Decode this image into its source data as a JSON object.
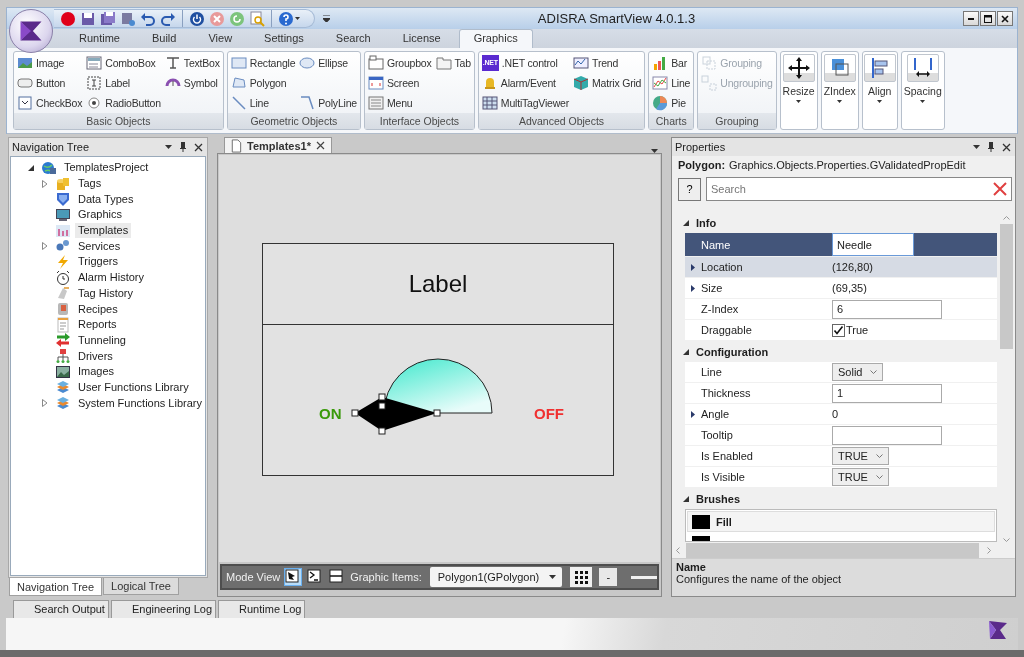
{
  "window": {
    "title": "ADISRA SmartView 4.0.1.3"
  },
  "ribbon_tabs": [
    {
      "label": "Runtime",
      "selected": false
    },
    {
      "label": "Build",
      "selected": false
    },
    {
      "label": "View",
      "selected": false
    },
    {
      "label": "Settings",
      "selected": false
    },
    {
      "label": "Search",
      "selected": false
    },
    {
      "label": "License",
      "selected": false
    },
    {
      "label": "Graphics",
      "selected": true
    }
  ],
  "ribbon_groups": [
    {
      "kind": "small",
      "title": "Basic Objects",
      "rows": [
        [
          {
            "label": "Image",
            "disabled": false
          },
          {
            "label": "ComboBox",
            "disabled": false
          },
          {
            "label": "TextBox",
            "disabled": false
          }
        ],
        [
          {
            "label": "Button",
            "disabled": false
          },
          {
            "label": "Label",
            "disabled": false
          },
          {
            "label": "Symbol",
            "disabled": false
          }
        ],
        [
          {
            "label": "CheckBox",
            "disabled": false
          },
          {
            "label": "RadioButton",
            "disabled": false
          }
        ]
      ]
    },
    {
      "kind": "small",
      "title": "Geometric Objects",
      "rows": [
        [
          {
            "label": "Rectangle",
            "disabled": false
          },
          {
            "label": "Ellipse",
            "disabled": false
          }
        ],
        [
          {
            "label": "Polygon",
            "disabled": false
          }
        ],
        [
          {
            "label": "Line",
            "disabled": false
          },
          {
            "label": "PolyLine",
            "disabled": false
          }
        ]
      ]
    },
    {
      "kind": "small",
      "title": "Interface Objects",
      "rows": [
        [
          {
            "label": "Groupbox",
            "disabled": false
          },
          {
            "label": "Tab",
            "disabled": false
          }
        ],
        [
          {
            "label": "Screen",
            "disabled": false
          }
        ],
        [
          {
            "label": "Menu",
            "disabled": false
          }
        ]
      ]
    },
    {
      "kind": "small",
      "title": "Advanced Objects",
      "rows": [
        [
          {
            "label": ".NET control",
            "badge": ".NET",
            "disabled": false
          },
          {
            "label": "Trend",
            "disabled": false
          }
        ],
        [
          {
            "label": "Alarm/Event",
            "disabled": false
          },
          {
            "label": "Matrix Grid",
            "disabled": false
          }
        ],
        [
          {
            "label": "MultiTagViewer",
            "disabled": false
          }
        ]
      ]
    },
    {
      "kind": "small",
      "title": "Charts",
      "rows": [
        [
          {
            "label": "Bar",
            "disabled": false
          }
        ],
        [
          {
            "label": "Line",
            "disabled": false
          }
        ],
        [
          {
            "label": "Pie",
            "disabled": false
          }
        ]
      ]
    },
    {
      "kind": "small",
      "title": "Grouping",
      "rows": [
        [
          {
            "label": "Grouping",
            "disabled": true
          }
        ],
        [
          {
            "label": "Ungrouping",
            "disabled": true
          }
        ]
      ]
    },
    {
      "kind": "large",
      "label": "Resize"
    },
    {
      "kind": "large",
      "label": "ZIndex"
    },
    {
      "kind": "large",
      "label": "Align"
    },
    {
      "kind": "large",
      "label": "Spacing"
    }
  ],
  "navigation_tree": {
    "title": "Navigation Tree",
    "items": [
      {
        "label": "TemplatesProject",
        "expanded": true,
        "selected": false,
        "children": [
          {
            "label": "Tags",
            "expanded": false,
            "selected": false
          },
          {
            "label": "Data Types",
            "selected": false
          },
          {
            "label": "Graphics",
            "selected": false
          },
          {
            "label": "Templates",
            "selected": true
          },
          {
            "label": "Services",
            "expanded": false,
            "selected": false
          },
          {
            "label": "Triggers",
            "selected": false
          },
          {
            "label": "Alarm History",
            "selected": false
          },
          {
            "label": "Tag History",
            "selected": false
          },
          {
            "label": "Recipes",
            "selected": false
          },
          {
            "label": "Reports",
            "selected": false
          },
          {
            "label": "Tunneling",
            "selected": false
          },
          {
            "label": "Drivers",
            "selected": false
          },
          {
            "label": "Images",
            "selected": false
          },
          {
            "label": "User Functions Library",
            "selected": false
          },
          {
            "label": "System Functions Library",
            "expanded": false,
            "selected": false
          }
        ]
      }
    ]
  },
  "left_panel_tabs": [
    {
      "label": "Navigation Tree",
      "selected": true
    },
    {
      "label": "Logical Tree",
      "selected": false
    }
  ],
  "document": {
    "tabs": [
      {
        "label": "Templates1*",
        "selected": true
      }
    ],
    "canvas": {
      "header_label": "Label",
      "on_text": "ON",
      "off_text": "OFF"
    },
    "mode_bar": {
      "label": "Mode View",
      "modes": [
        {
          "selected": true
        },
        {
          "selected": false
        },
        {
          "selected": false
        }
      ],
      "graphic_items_label": "Graphic Items:",
      "graphic_items_value": "Polygon1(GPolygon)",
      "zoom_out": "-"
    }
  },
  "properties": {
    "title": "Properties",
    "object_type": "Polygon:",
    "object_class": "Graphics.Objects.Properties.GValidatedPropEdit",
    "help": "?",
    "search_placeholder": "Search",
    "sections": [
      {
        "title": "Info",
        "expanded": true,
        "rows": [
          {
            "label": "Name",
            "kind": "text",
            "value": "Needle",
            "expandable": false,
            "selected": true,
            "hovered": false
          },
          {
            "label": "Location",
            "kind": "plain",
            "value": "(126,80)",
            "expandable": true,
            "selected": false,
            "hovered": true
          },
          {
            "label": "Size",
            "kind": "plain",
            "value": "(69,35)",
            "expandable": true,
            "selected": false,
            "hovered": false
          },
          {
            "label": "Z-Index",
            "kind": "text",
            "value": "6",
            "expandable": false,
            "selected": false,
            "hovered": false
          },
          {
            "label": "Draggable",
            "kind": "check",
            "checked": true,
            "value": "True",
            "expandable": false,
            "selected": false,
            "hovered": false
          }
        ]
      },
      {
        "title": "Configuration",
        "expanded": true,
        "rows": [
          {
            "label": "Line",
            "kind": "select",
            "value": "Solid",
            "expandable": false,
            "selected": false,
            "hovered": false
          },
          {
            "label": "Thickness",
            "kind": "text",
            "value": "1",
            "expandable": false,
            "selected": false,
            "hovered": false
          },
          {
            "label": "Angle",
            "kind": "plain",
            "value": "0",
            "expandable": true,
            "selected": false,
            "hovered": false
          },
          {
            "label": "Tooltip",
            "kind": "text",
            "expandable": false,
            "selected": false,
            "hovered": false
          },
          {
            "label": "Is Enabled",
            "kind": "select",
            "value": "TRUE",
            "expandable": false,
            "selected": false,
            "hovered": false
          },
          {
            "label": "Is Visible",
            "kind": "select",
            "value": "TRUE",
            "expandable": false,
            "selected": false,
            "hovered": false
          }
        ]
      },
      {
        "title": "Brushes",
        "expanded": true,
        "brushes": [
          {
            "label": "Fill",
            "color": "#000000",
            "selected": true
          },
          {
            "color": "#000000",
            "selected": false
          }
        ]
      }
    ],
    "description": {
      "title": "Name",
      "text": "Configures the name of the object"
    }
  },
  "output_tabs": [
    {
      "label": "Search Output"
    },
    {
      "label": "Engineering Log"
    },
    {
      "label": "Runtime Log"
    }
  ]
}
